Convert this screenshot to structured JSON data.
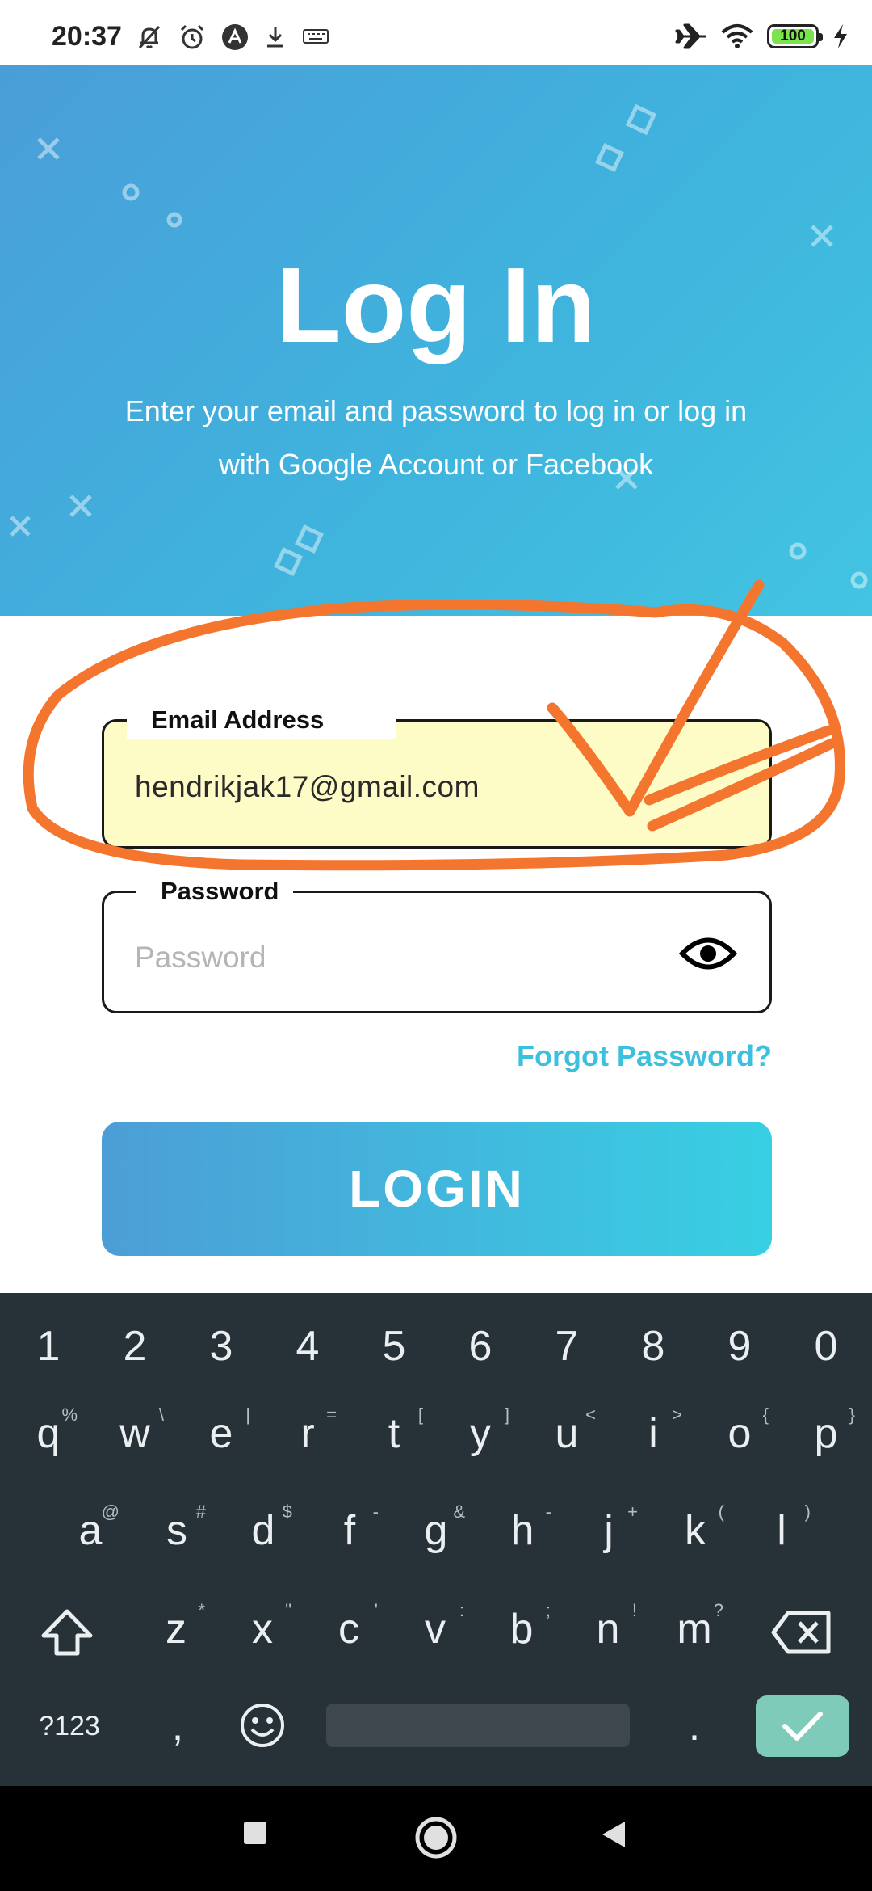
{
  "status_bar": {
    "time": "20:37",
    "battery_level": "100",
    "battery_fraction": 1.0,
    "icons_left": [
      "mute-bell-icon",
      "alarm-icon",
      "app-notification-icon",
      "download-icon",
      "keyboard-icon"
    ],
    "icons_right": [
      "airplane-icon",
      "wifi-icon",
      "battery-icon",
      "charging-icon"
    ]
  },
  "header": {
    "title": "Log In",
    "subtitle_line1": "Enter your email and password to log in or log in",
    "subtitle_line2": "with Google Account or Facebook",
    "gradient_start": "#4a9ed8",
    "gradient_end": "#42c4e2"
  },
  "form": {
    "email": {
      "label": "Email Address",
      "value": "hendrikjak17@gmail.com",
      "fill": "#fdfcc6"
    },
    "password": {
      "label": "Password",
      "placeholder": "Password",
      "toggle_icon": "eye-icon"
    },
    "forgot_label": "Forgot Password?",
    "login_label": "LOGIN",
    "accent_color": "#3cc0de"
  },
  "annotation": {
    "color": "#f4762e",
    "shapes": [
      "circle-around-email",
      "checkmark"
    ]
  },
  "keyboard": {
    "number_row": [
      "1",
      "2",
      "3",
      "4",
      "5",
      "6",
      "7",
      "8",
      "9",
      "0"
    ],
    "row1": [
      {
        "k": "q",
        "h": "%"
      },
      {
        "k": "w",
        "h": "\\"
      },
      {
        "k": "e",
        "h": "|"
      },
      {
        "k": "r",
        "h": "="
      },
      {
        "k": "t",
        "h": "["
      },
      {
        "k": "y",
        "h": "]"
      },
      {
        "k": "u",
        "h": "<"
      },
      {
        "k": "i",
        "h": ">"
      },
      {
        "k": "o",
        "h": "{"
      },
      {
        "k": "p",
        "h": "}"
      }
    ],
    "row2": [
      {
        "k": "a",
        "h": "@"
      },
      {
        "k": "s",
        "h": "#"
      },
      {
        "k": "d",
        "h": "$"
      },
      {
        "k": "f",
        "h": "-"
      },
      {
        "k": "g",
        "h": "&"
      },
      {
        "k": "h",
        "h": "-"
      },
      {
        "k": "j",
        "h": "+"
      },
      {
        "k": "k",
        "h": "("
      },
      {
        "k": "l",
        "h": ")"
      }
    ],
    "row3": [
      {
        "k": "z",
        "h": "*"
      },
      {
        "k": "x",
        "h": "\""
      },
      {
        "k": "c",
        "h": "'"
      },
      {
        "k": "v",
        "h": ":"
      },
      {
        "k": "b",
        "h": ";"
      },
      {
        "k": "n",
        "h": "!"
      },
      {
        "k": "m",
        "h": "?"
      }
    ],
    "symbols_label": "?123",
    "comma": ",",
    "period": ".",
    "bg": "#263238",
    "enter_color": "#7fcbb9"
  },
  "nav": {
    "buttons": [
      "recents-icon",
      "home-icon",
      "back-icon"
    ]
  }
}
